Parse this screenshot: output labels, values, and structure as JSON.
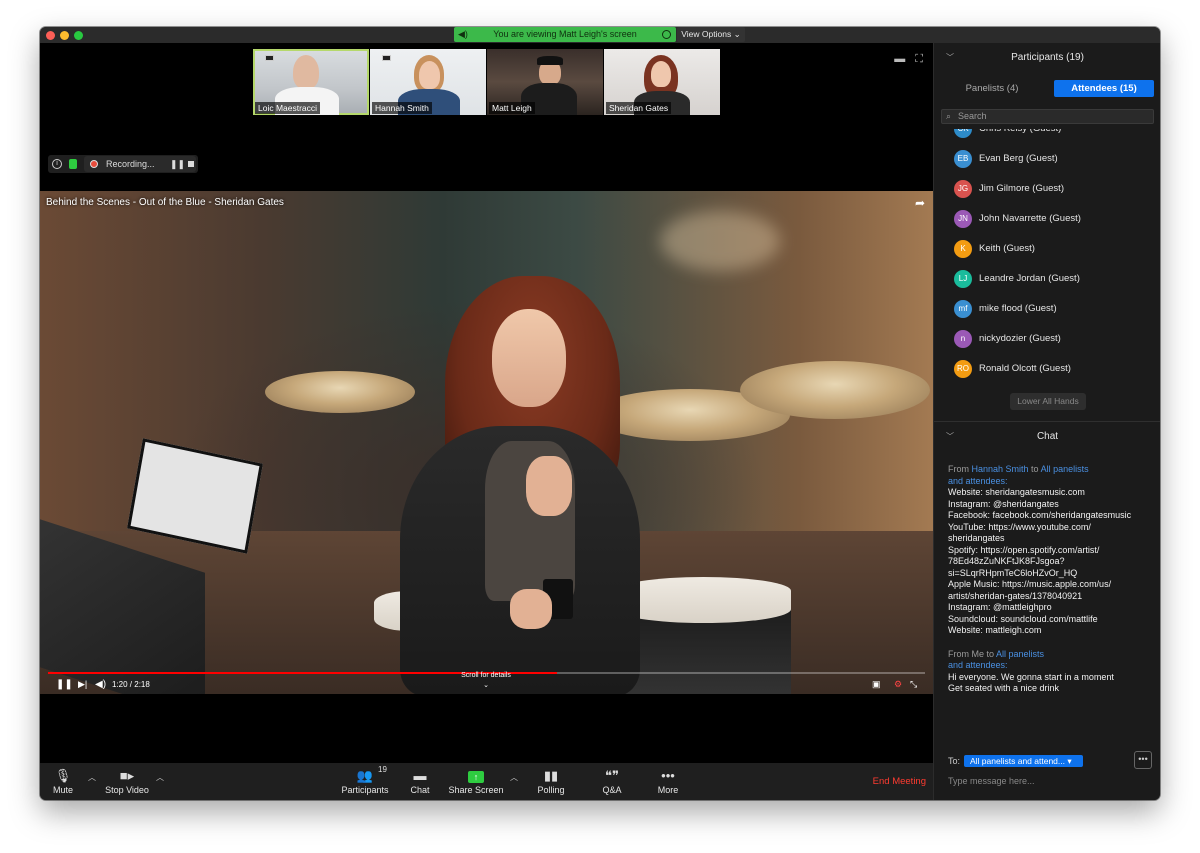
{
  "banner": {
    "viewing_text": "You are viewing Matt Leigh's screen",
    "view_options": "View Options"
  },
  "thumbnails": [
    {
      "name": "Loic Maestracci",
      "active": true
    },
    {
      "name": "Hannah Smith",
      "active": false
    },
    {
      "name": "Matt Leigh",
      "active": false
    },
    {
      "name": "Sheridan Gates",
      "active": false
    }
  ],
  "recording": {
    "label": "Recording...",
    "pause_glyph": "❚❚"
  },
  "video": {
    "title": "Behind the Scenes - Out of the Blue - Sheridan Gates",
    "time": "1:20 / 2:18",
    "progress": 0.58,
    "scroll_hint": "Scroll for details"
  },
  "toolbar": {
    "mute": "Mute",
    "stop_video": "Stop Video",
    "participants": "Participants",
    "participants_count": "19",
    "chat": "Chat",
    "share_screen": "Share Screen",
    "polling": "Polling",
    "qa": "Q&A",
    "more": "More",
    "end_meeting": "End Meeting"
  },
  "participants_panel": {
    "title": "Participants (19)",
    "tab_panelists": "Panelists (4)",
    "tab_attendees": "Attendees (15)",
    "search_placeholder": "Search",
    "list": [
      {
        "initials": "CK",
        "name": "Chris Kelsy (Guest)",
        "color": "#2d8bc9"
      },
      {
        "initials": "EB",
        "name": "Evan Berg (Guest)",
        "color": "#3a8fd1"
      },
      {
        "initials": "JG",
        "name": "Jim Gilmore (Guest)",
        "color": "#d9534f"
      },
      {
        "initials": "JN",
        "name": "John Navarrette (Guest)",
        "color": "#9b59b6"
      },
      {
        "initials": "K",
        "name": "Keith (Guest)",
        "color": "#f39c12"
      },
      {
        "initials": "LJ",
        "name": "Leandre Jordan (Guest)",
        "color": "#1abc9c"
      },
      {
        "initials": "mf",
        "name": "mike flood (Guest)",
        "color": "#3a8fd1"
      },
      {
        "initials": "n",
        "name": "nickydozier (Guest)",
        "color": "#9b59b6"
      },
      {
        "initials": "RO",
        "name": "Ronald Olcott (Guest)",
        "color": "#f39c12"
      }
    ],
    "lower_hands": "Lower All Hands"
  },
  "chat": {
    "title": "Chat",
    "messages": [
      {
        "from_prefix": "From ",
        "from_name": "Hannah Smith",
        "to_word": " to ",
        "to_name": "All panelists",
        "to_tail": "and attendees:",
        "text": "Website: sheridangatesmusic.com\nInstagram: @sheridangates\nFacebook: facebook.com/sheridangatesmusic\nYouTube: https://www.youtube.com/\nsheridangates\nSpotify: https://open.spotify.com/artist/\n78Ed48zZuNKFtJK8FJsgoa?\nsi=SLqrRHpmTeC6loHZvOr_HQ\nApple Music: https://music.apple.com/us/\nartist/sheridan-gates/1378040921\nInstagram: @mattleighpro\nSoundcloud: soundcloud.com/mattlife\nWebsite: mattleigh.com"
      },
      {
        "from_prefix": "From ",
        "from_name": "Me",
        "to_word": " to ",
        "to_name": "All panelists",
        "to_tail": "and attendees:",
        "text": "Hi everyone. We gonna start in a moment\nGet seated with a nice drink"
      }
    ],
    "to_label": "To:",
    "to_value": "All panelists and attend...",
    "input_placeholder": "Type message here..."
  },
  "colors": {
    "accent": "#0e72ed",
    "banner_green": "#3cb94a",
    "end_red": "#ff3b30",
    "progress_red": "#ff0000"
  }
}
